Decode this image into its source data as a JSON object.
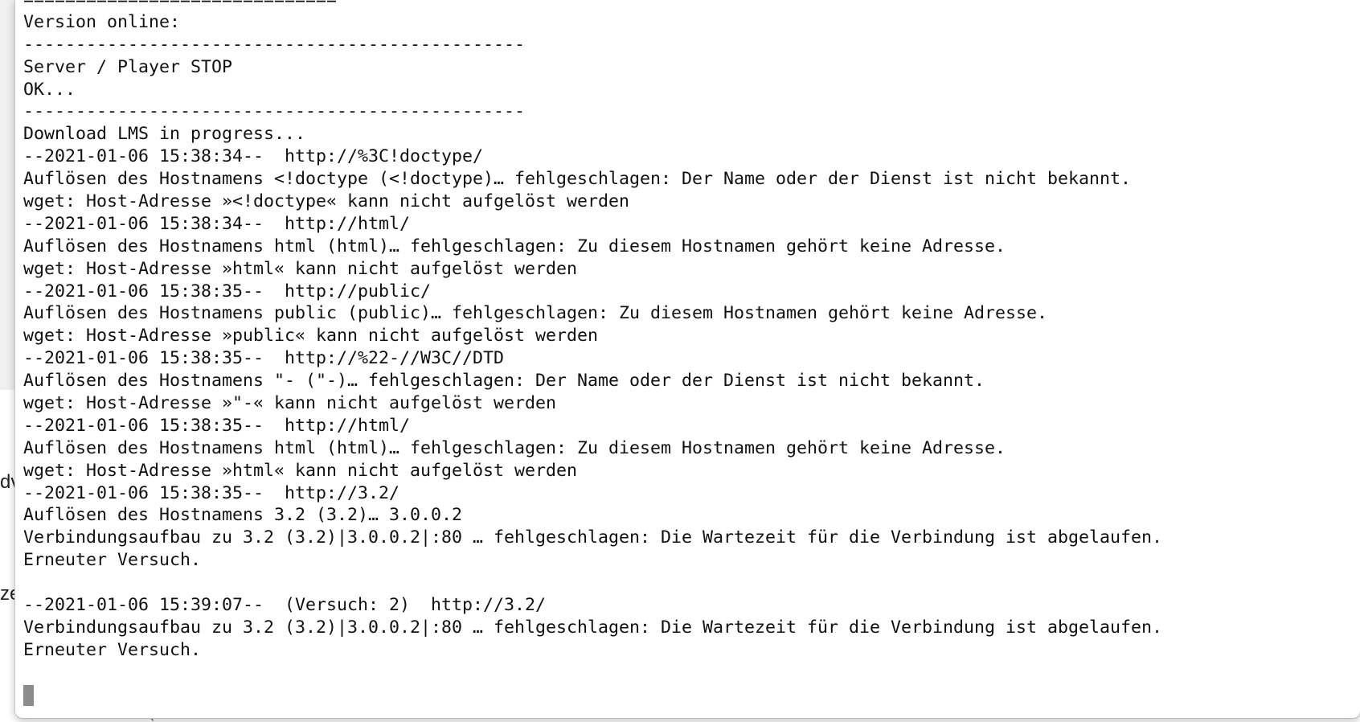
{
  "background": {
    "fragments": [
      "dv",
      "ze",
      "i",
      "(r…"
    ]
  },
  "terminal": {
    "lines": [
      "==============================",
      "Version online:",
      "------------------------------------------------",
      "Server / Player STOP",
      "OK...",
      "------------------------------------------------",
      "Download LMS in progress...",
      "--2021-01-06 15:38:34--  http://%3C!doctype/",
      "Auflösen des Hostnamens <!doctype (<!doctype)… fehlgeschlagen: Der Name oder der Dienst ist nicht bekannt.",
      "wget: Host-Adresse »<!doctype« kann nicht aufgelöst werden",
      "--2021-01-06 15:38:34--  http://html/",
      "Auflösen des Hostnamens html (html)… fehlgeschlagen: Zu diesem Hostnamen gehört keine Adresse.",
      "wget: Host-Adresse »html« kann nicht aufgelöst werden",
      "--2021-01-06 15:38:35--  http://public/",
      "Auflösen des Hostnamens public (public)… fehlgeschlagen: Zu diesem Hostnamen gehört keine Adresse.",
      "wget: Host-Adresse »public« kann nicht aufgelöst werden",
      "--2021-01-06 15:38:35--  http://%22-//W3C//DTD",
      "Auflösen des Hostnamens \"- (\"-)… fehlgeschlagen: Der Name oder der Dienst ist nicht bekannt.",
      "wget: Host-Adresse »\"-« kann nicht aufgelöst werden",
      "--2021-01-06 15:38:35--  http://html/",
      "Auflösen des Hostnamens html (html)… fehlgeschlagen: Zu diesem Hostnamen gehört keine Adresse.",
      "wget: Host-Adresse »html« kann nicht aufgelöst werden",
      "--2021-01-06 15:38:35--  http://3.2/",
      "Auflösen des Hostnamens 3.2 (3.2)… 3.0.0.2",
      "Verbindungsaufbau zu 3.2 (3.2)|3.0.0.2|:80 … fehlgeschlagen: Die Wartezeit für die Verbindung ist abgelaufen.",
      "Erneuter Versuch.",
      "",
      "--2021-01-06 15:39:07--  (Versuch: 2)  http://3.2/",
      "Verbindungsaufbau zu 3.2 (3.2)|3.0.0.2|:80 … fehlgeschlagen: Die Wartezeit für die Verbindung ist abgelaufen.",
      "Erneuter Versuch.",
      ""
    ]
  },
  "colors": {
    "terminal_text": "#111111",
    "terminal_background": "#ffffff",
    "cursor": "#8c8c8c"
  }
}
